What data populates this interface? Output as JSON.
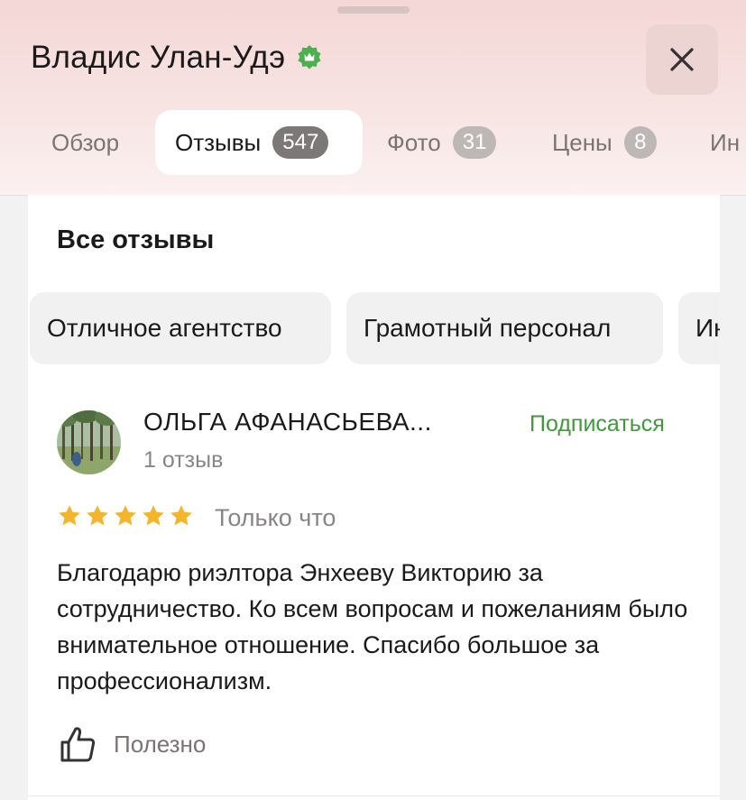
{
  "header": {
    "title": "Владис Улан-Удэ",
    "verified_icon": "verified-badge-icon",
    "close_icon": "close-icon"
  },
  "tabs": [
    {
      "label": "Обзор",
      "badge": null
    },
    {
      "label": "Отзывы",
      "badge": "547",
      "active": true
    },
    {
      "label": "Фото",
      "badge": "31"
    },
    {
      "label": "Цены",
      "badge": "8"
    },
    {
      "label": "Ин",
      "badge": null
    }
  ],
  "reviews_section": {
    "title": "Все отзывы",
    "chips": [
      "Отличное агентство",
      "Грамотный персонал",
      "Ин"
    ]
  },
  "review": {
    "author": "ОЛЬГА АФАНАСЬЕВА...",
    "author_meta": "1 отзыв",
    "subscribe_label": "Подписаться",
    "rating": 5,
    "time": "Только что",
    "text": "Благодарю риэлтора Энхееву Викторию за сотрудничество. Ко всем вопросам и пожеланиям было внимательное отношение. Спасибо большое за профессионализм.",
    "helpful_label": "Полезно"
  },
  "colors": {
    "accent_green": "#3f9a3a",
    "star_gold": "#f4b42b",
    "verified_green": "#4caf50"
  }
}
